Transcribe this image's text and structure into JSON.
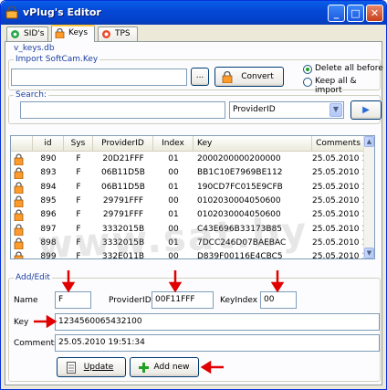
{
  "window": {
    "title": "vPlug's Editor"
  },
  "tabs": [
    {
      "label": "SID's"
    },
    {
      "label": "Keys"
    },
    {
      "label": "TPS"
    }
  ],
  "file_label": "v_keys.db",
  "import": {
    "group_title": "Import SoftCam.Key",
    "path_value": "",
    "browse_label": "...",
    "convert_label": "Convert",
    "options": [
      {
        "label": "Delete all before",
        "selected": true
      },
      {
        "label": "Keep all & import",
        "selected": false
      }
    ]
  },
  "search": {
    "label": "Search:",
    "value": "",
    "field_selected": "ProviderID"
  },
  "table": {
    "columns": [
      "id",
      "Sys",
      "ProviderID",
      "Index",
      "Key",
      "Comments"
    ],
    "rows": [
      {
        "id": "890",
        "sys": "F",
        "provider": "20D21FFF",
        "index": "01",
        "key": "2000200000200000",
        "comments": "25.05.2010 1"
      },
      {
        "id": "893",
        "sys": "F",
        "provider": "06B11D5B",
        "index": "00",
        "key": "BB1C10E7969BE112",
        "comments": "25.05.2010 1"
      },
      {
        "id": "894",
        "sys": "F",
        "provider": "06B11D5B",
        "index": "01",
        "key": "190CD7FC015E9CFB",
        "comments": "25.05.2010 1"
      },
      {
        "id": "895",
        "sys": "F",
        "provider": "29791FFF",
        "index": "00",
        "key": "0102030004050600",
        "comments": "25.05.2010 1"
      },
      {
        "id": "896",
        "sys": "F",
        "provider": "29791FFF",
        "index": "01",
        "key": "0102030004050600",
        "comments": "25.05.2010 1"
      },
      {
        "id": "897",
        "sys": "F",
        "provider": "3332015B",
        "index": "00",
        "key": "C43E696B33173B85",
        "comments": "25.05.2010 1"
      },
      {
        "id": "898",
        "sys": "F",
        "provider": "3332015B",
        "index": "01",
        "key": "7DCC246D07BAEBAC",
        "comments": "25.05.2010 1"
      },
      {
        "id": "899",
        "sys": "F",
        "provider": "332E011B",
        "index": "00",
        "key": "D839F00116E4CBC5",
        "comments": "25.05.2010 1"
      }
    ]
  },
  "add_edit": {
    "group_title": "Add/Edit",
    "name_label": "Name",
    "name_value": "F",
    "provider_label": "ProviderID",
    "provider_value": "00F11FFF",
    "keyindex_label": "KeyIndex",
    "keyindex_value": "00",
    "key_label": "Key",
    "key_value": "1234560065432100",
    "comments_label": "Comments",
    "comments_value": "25.05.2010 19:51:34",
    "update_label": "Update",
    "addnew_label": "Add new"
  },
  "watermark": "www.sat.by",
  "colors": {
    "titlebar": "#0549d6",
    "arrow": "#e00000",
    "window_bg": "#ece9d8"
  }
}
